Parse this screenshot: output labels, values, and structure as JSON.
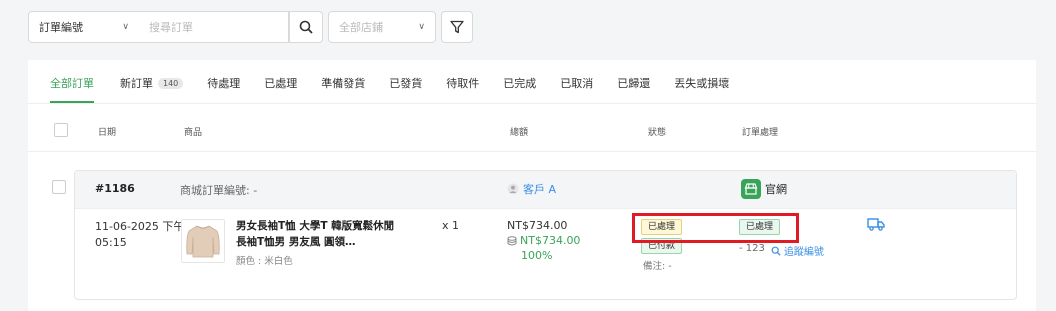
{
  "filters": {
    "order_field": "訂單編號",
    "search_placeholder": "搜尋訂單",
    "store_placeholder": "全部店鋪"
  },
  "tabs": [
    {
      "label": "全部訂單",
      "active": true
    },
    {
      "label": "新訂單",
      "count": "140"
    },
    {
      "label": "待處理"
    },
    {
      "label": "已處理"
    },
    {
      "label": "準備發貨"
    },
    {
      "label": "已發貨"
    },
    {
      "label": "待取件"
    },
    {
      "label": "已完成"
    },
    {
      "label": "已取消"
    },
    {
      "label": "已歸還"
    },
    {
      "label": "丟失或損壞"
    }
  ],
  "columns": {
    "date": "日期",
    "product": "商品",
    "total": "總額",
    "status": "狀態",
    "handling": "訂單處理"
  },
  "order": {
    "number": "#1186",
    "mall_no": "商城訂單編號: -",
    "customer": "客戶 A",
    "channel": "官網",
    "date": "11-06-2025 下午",
    "time": "05:15",
    "product_name": "男女長袖T恤 大學T 韓版寬鬆休閒長袖T恤男 男友風 圓領…",
    "variant": "顏色 : 米白色",
    "qty": "x 1",
    "price": "NT$734.00",
    "paid_amount": "NT$734.00",
    "paid_percent": "100%",
    "status_order": "已處理",
    "status_payment": "已付款",
    "note": "備注: -",
    "handling_status": "已處理",
    "tracking_no": "- 123",
    "tracking_link": "追蹤編號"
  },
  "colors": {
    "accent_green": "#3aa35a",
    "link_blue": "#3a8ee6",
    "highlight_red": "#e01b24"
  }
}
